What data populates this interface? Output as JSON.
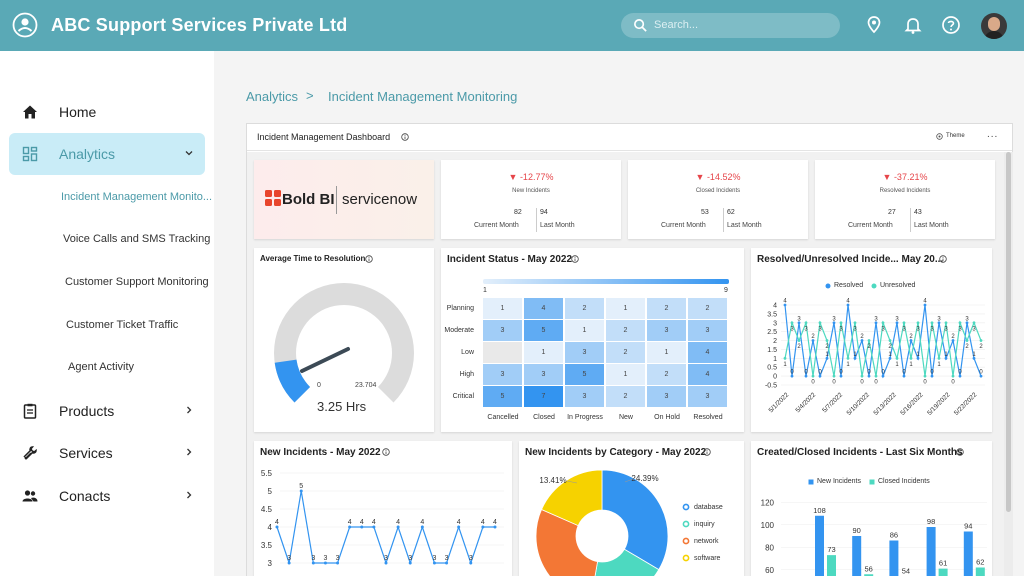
{
  "header": {
    "title": "ABC Support Services Private Ltd",
    "search_placeholder": "Search..."
  },
  "sidebar": {
    "items": [
      {
        "label": "Home"
      },
      {
        "label": "Analytics"
      },
      {
        "label": "Products"
      },
      {
        "label": "Services"
      },
      {
        "label": "Conacts"
      }
    ],
    "analytics_sub": [
      "Incident Management Monito...",
      "Voice Calls and SMS Tracking",
      "Customer Support Monitoring",
      "Customer Ticket Traffic",
      "Agent Activity"
    ]
  },
  "breadcrumb": {
    "root": "Analytics",
    "sep": ">",
    "current": "Incident Management Monitoring"
  },
  "dashboard": {
    "title": "Incident Management Dashboard",
    "theme_label": "Theme",
    "more_label": "...",
    "logo": {
      "left": "Bold BI",
      "right": "servicenow"
    },
    "kpis": [
      {
        "change": "-12.77%",
        "label": "New Incidents",
        "current": "82",
        "last": "94",
        "current_label": "Current Month",
        "last_label": "Last Month"
      },
      {
        "change": "-14.52%",
        "label": "Closed Incidents",
        "current": "53",
        "last": "62",
        "current_label": "Current Month",
        "last_label": "Last Month"
      },
      {
        "change": "-37.21%",
        "label": "Resolved Incidents",
        "current": "27",
        "last": "43",
        "current_label": "Current Month",
        "last_label": "Last Month"
      }
    ],
    "colors": {
      "accent": "#5aa9b6",
      "negative": "#e6454a",
      "blue": "#3394f0",
      "teal": "#4dd9c0",
      "yellow": "#f6d200",
      "orange": "#f37735"
    }
  },
  "chart_data": [
    {
      "type": "gauge",
      "title": "Average Time to Resolution",
      "min": "0",
      "max": "23.704",
      "value": 3.25,
      "value_label": "3.25 Hrs"
    },
    {
      "type": "heatmap",
      "title": "Incident Status - May 2022",
      "rows": [
        "Planning",
        "Moderate",
        "Low",
        "High",
        "Critical"
      ],
      "columns": [
        "Cancelled",
        "Closed",
        "In Progress",
        "New",
        "On Hold",
        "Resolved"
      ],
      "values": [
        [
          1,
          4,
          2,
          1,
          2,
          2
        ],
        [
          3,
          5,
          1,
          2,
          3,
          3
        ],
        [
          null,
          1,
          3,
          2,
          1,
          4
        ],
        [
          3,
          3,
          5,
          1,
          2,
          4
        ],
        [
          5,
          7,
          3,
          2,
          3,
          3
        ]
      ],
      "legend_min": "1",
      "legend_max": "9"
    },
    {
      "type": "line",
      "title": "Resolved/Unresolved Incide... May 20...",
      "ylim": [
        -0.5,
        4
      ],
      "yticks": [
        "4",
        "3.5",
        "3",
        "2.5",
        "2",
        "1.5",
        "1",
        "0.5",
        "0",
        "-0.5"
      ],
      "xticks": [
        "5/1/2022",
        "5/4/2022",
        "5/7/2022",
        "5/10/2022",
        "5/13/2022",
        "5/16/2022",
        "5/19/2022",
        "5/22/2022"
      ],
      "series": [
        {
          "name": "Resolved",
          "values": [
            4,
            0,
            3,
            0,
            2,
            0,
            1,
            3,
            0,
            4,
            1,
            2,
            0,
            3,
            0,
            1,
            3,
            0,
            2,
            1,
            4,
            0,
            3,
            1,
            2,
            0,
            3,
            1,
            0
          ]
        },
        {
          "name": "Unresolved",
          "values": [
            1,
            3,
            2,
            3,
            0,
            3,
            2,
            0,
            3,
            1,
            3,
            0,
            2,
            0,
            3,
            2,
            1,
            3,
            1,
            3,
            0,
            3,
            1,
            3,
            0,
            3,
            2,
            3,
            2
          ]
        }
      ]
    },
    {
      "type": "line",
      "title": "New Incidents - May 2022",
      "ylim": [
        2.5,
        5.5
      ],
      "yticks": [
        "5.5",
        "5",
        "4.5",
        "4",
        "3.5",
        "3"
      ],
      "series": [
        {
          "name": "",
          "values": [
            4,
            3,
            5,
            3,
            3,
            3,
            4,
            4,
            4,
            3,
            4,
            3,
            4,
            3,
            3,
            4,
            3,
            4,
            4
          ]
        }
      ]
    },
    {
      "type": "pie",
      "title": "New Incidents by Category - May 2022",
      "slices": [
        {
          "name": "database",
          "value": 24.39,
          "color": "#3394f0"
        },
        {
          "name": "inquiry",
          "value": 14.0,
          "color": "#4dd9c0"
        },
        {
          "name": "network",
          "value": 21.0,
          "color": "#f37735"
        },
        {
          "name": "software",
          "value": 13.41,
          "color": "#f6d200"
        }
      ],
      "labels": [
        "13.41%",
        "24.39%"
      ],
      "legend": [
        "database",
        "inquiry",
        "network",
        "software"
      ]
    },
    {
      "type": "bar",
      "title": "Created/Closed Incidents - Last Six Months",
      "ylim": [
        50,
        130
      ],
      "yticks": [
        "120",
        "100",
        "80",
        "60"
      ],
      "series": [
        {
          "name": "New Incidents",
          "values": [
            108,
            90,
            86,
            98,
            94
          ]
        },
        {
          "name": "Closed Incidents",
          "values": [
            73,
            56,
            54,
            61,
            62
          ]
        }
      ]
    }
  ]
}
